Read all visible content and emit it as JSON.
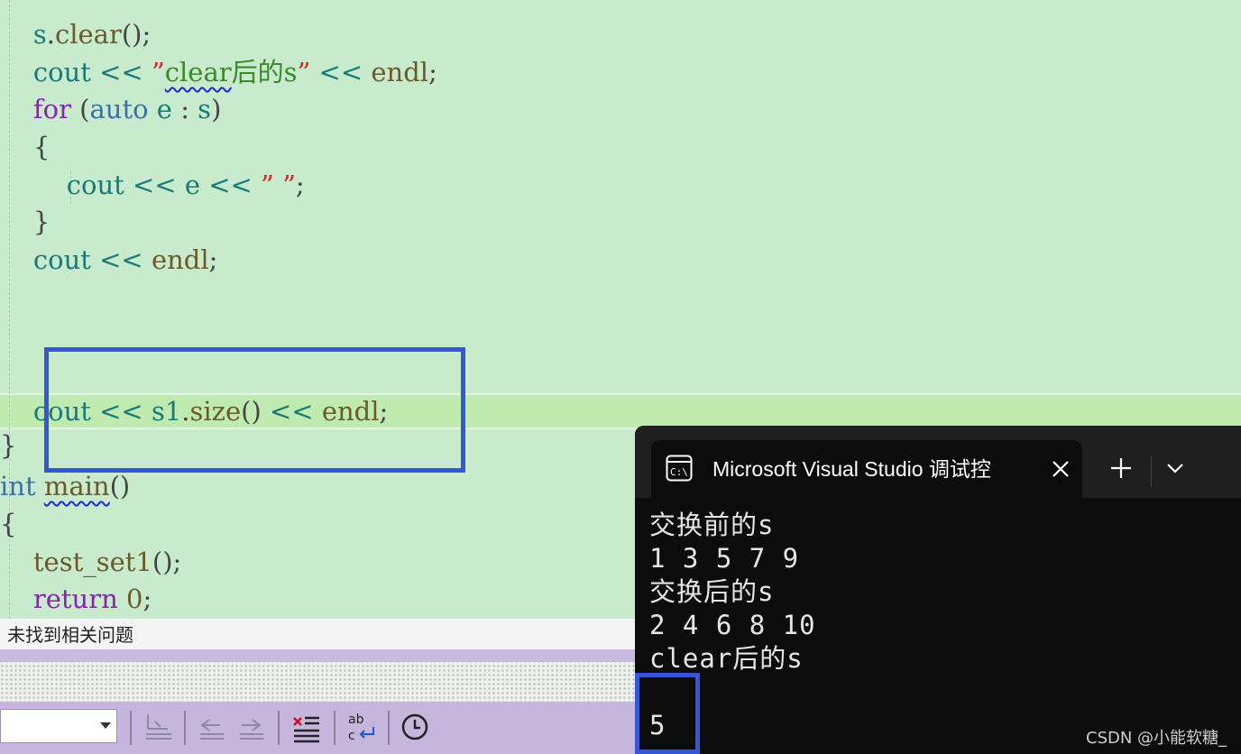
{
  "editor": {
    "lines": [
      {
        "parts": [
          {
            "t": "    s",
            "c": "id"
          },
          {
            "t": ".",
            "c": "pun"
          },
          {
            "t": "clear",
            "c": "fn"
          },
          {
            "t": "();",
            "c": "pun"
          }
        ]
      },
      {
        "parts": [
          {
            "t": "    cout",
            "c": "id"
          },
          {
            "t": " << ",
            "c": "op"
          },
          {
            "t": "”",
            "c": "str-q"
          },
          {
            "t": "clear",
            "c": "str squig"
          },
          {
            "t": "后的s",
            "c": "str"
          },
          {
            "t": "”",
            "c": "str-q"
          },
          {
            "t": " << ",
            "c": "op"
          },
          {
            "t": "endl",
            "c": "fn"
          },
          {
            "t": ";",
            "c": "pun"
          }
        ]
      },
      {
        "parts": [
          {
            "t": "    for",
            "c": "kw"
          },
          {
            "t": " (",
            "c": "pun"
          },
          {
            "t": "auto",
            "c": "kw2"
          },
          {
            "t": " e ",
            "c": "id"
          },
          {
            "t": ":",
            "c": "pun"
          },
          {
            "t": " s",
            "c": "id"
          },
          {
            "t": ")",
            "c": "pun"
          }
        ]
      },
      {
        "parts": [
          {
            "t": "    {",
            "c": "pun"
          }
        ]
      },
      {
        "parts": [
          {
            "t": "        cout",
            "c": "id"
          },
          {
            "t": " << ",
            "c": "op"
          },
          {
            "t": "e",
            "c": "id"
          },
          {
            "t": " << ",
            "c": "op"
          },
          {
            "t": "” ”",
            "c": "str-q"
          },
          {
            "t": ";",
            "c": "pun"
          }
        ]
      },
      {
        "parts": [
          {
            "t": "    }",
            "c": "pun"
          }
        ]
      },
      {
        "parts": [
          {
            "t": "    cout",
            "c": "id"
          },
          {
            "t": " << ",
            "c": "op"
          },
          {
            "t": "endl",
            "c": "fn"
          },
          {
            "t": ";",
            "c": "pun"
          }
        ]
      },
      {
        "parts": []
      },
      {
        "parts": []
      },
      {
        "parts": []
      },
      {
        "parts": [
          {
            "t": "    cout",
            "c": "id"
          },
          {
            "t": " << ",
            "c": "op"
          },
          {
            "t": "s1",
            "c": "id"
          },
          {
            "t": ".",
            "c": "pun"
          },
          {
            "t": "size",
            "c": "fn"
          },
          {
            "t": "()",
            "c": "pun"
          },
          {
            "t": " << ",
            "c": "op"
          },
          {
            "t": "endl",
            "c": "fn"
          },
          {
            "t": ";",
            "c": "pun"
          }
        ]
      },
      {
        "parts": [
          {
            "t": "}",
            "c": "pun"
          }
        ]
      },
      {
        "parts": [
          {
            "t": "int",
            "c": "kw2"
          },
          {
            "t": " ",
            "c": "pun"
          },
          {
            "t": "main",
            "c": "fn squig"
          },
          {
            "t": "()",
            "c": "pun"
          }
        ]
      },
      {
        "parts": [
          {
            "t": "{",
            "c": "pun"
          }
        ]
      },
      {
        "parts": [
          {
            "t": "    test_set1",
            "c": "fn"
          },
          {
            "t": "();",
            "c": "pun"
          }
        ]
      },
      {
        "parts": [
          {
            "t": "    return",
            "c": "kw"
          },
          {
            "t": " ",
            "c": "pun"
          },
          {
            "t": "0",
            "c": "num"
          },
          {
            "t": ";",
            "c": "pun"
          }
        ]
      }
    ]
  },
  "error_list": {
    "message": "未找到相关问题"
  },
  "toolbar": {
    "icons": [
      "indent-icon",
      "outdent-left-icon",
      "outdent-right-icon",
      "clear-list-icon",
      "spell-check-icon",
      "history-icon"
    ]
  },
  "terminal": {
    "tab_title": "Microsoft Visual Studio 调试控",
    "new_tab_label": "+",
    "output_lines": [
      "交换前的s",
      "1 3 5 7 9",
      "交换后的s",
      "2 4 6 8 10",
      "clear后的s",
      "",
      "5"
    ]
  },
  "watermark": "CSDN @小能软糖_",
  "colors": {
    "highlight_box": "#3556d6",
    "editor_bg": "#c7ebcc",
    "terminal_bg": "#0c0c0c"
  }
}
